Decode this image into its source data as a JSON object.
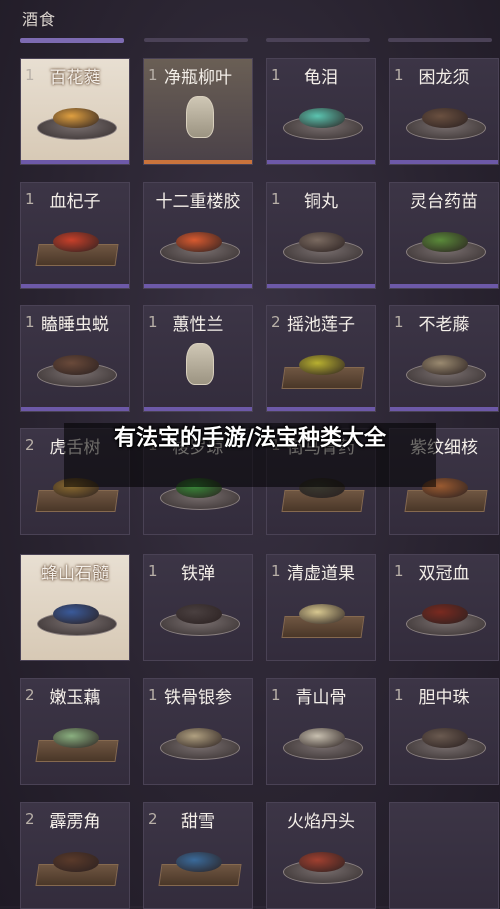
{
  "header": {
    "title": "酒食"
  },
  "overlay": {
    "title": "有法宝的手游/法宝种类大全"
  },
  "items": [
    {
      "count": "1",
      "name": "百花蕤",
      "state": "special",
      "visual": "plate",
      "color": "#e0a040"
    },
    {
      "count": "1",
      "name": "净瓶柳叶",
      "state": "selected",
      "visual": "vase",
      "color": "#b8b090"
    },
    {
      "count": "1",
      "name": "龟泪",
      "state": "normal",
      "visual": "plate",
      "color": "#5bc4b0"
    },
    {
      "count": "1",
      "name": "困龙须",
      "state": "normal",
      "visual": "plate",
      "color": "#6a5040"
    },
    {
      "count": "1",
      "name": "血杞子",
      "state": "normal",
      "visual": "tray",
      "color": "#c8402a"
    },
    {
      "count": "",
      "name": "十二重楼胶",
      "state": "normal",
      "visual": "plate",
      "color": "#d85a30"
    },
    {
      "count": "1",
      "name": "铜丸",
      "state": "normal",
      "visual": "plate",
      "color": "#7a6a60"
    },
    {
      "count": "",
      "name": "灵台药苗",
      "state": "normal",
      "visual": "plate",
      "color": "#5a8a3a"
    },
    {
      "count": "1",
      "name": "瞌睡虫蜕",
      "state": "normal",
      "visual": "plate",
      "color": "#6a4a3a"
    },
    {
      "count": "1",
      "name": "蕙性兰",
      "state": "normal",
      "visual": "vase",
      "color": "#b0a8a0"
    },
    {
      "count": "2",
      "name": "摇池莲子",
      "state": "normal",
      "visual": "tray",
      "color": "#b8b030"
    },
    {
      "count": "1",
      "name": "不老藤",
      "state": "normal",
      "visual": "plate",
      "color": "#9a8a70"
    },
    {
      "count": "2",
      "name": "虎舌树",
      "state": "normal",
      "visual": "tray",
      "color": "#8a6a30"
    },
    {
      "count": "1",
      "name": "梭罗琼",
      "state": "normal",
      "visual": "plate",
      "color": "#3a8a3a"
    },
    {
      "count": "1",
      "name": "街马骨药",
      "state": "normal",
      "visual": "tray",
      "color": "#3a3a30"
    },
    {
      "count": "",
      "name": "紫纹细核",
      "state": "normal",
      "visual": "tray",
      "color": "#9a5a30"
    },
    {
      "count": "",
      "name": "蜂山石髓",
      "state": "special",
      "visual": "plate",
      "color": "#3a5a9a"
    },
    {
      "count": "1",
      "name": "铁弹",
      "state": "normal",
      "visual": "plate",
      "color": "#4a4040"
    },
    {
      "count": "1",
      "name": "清虚道果",
      "state": "normal",
      "visual": "tray",
      "color": "#d8c890"
    },
    {
      "count": "1",
      "name": "双冠血",
      "state": "normal",
      "visual": "plate",
      "color": "#7a2a20"
    },
    {
      "count": "2",
      "name": "嫩玉藕",
      "state": "normal",
      "visual": "tray",
      "color": "#8ab080"
    },
    {
      "count": "1",
      "name": "铁骨银参",
      "state": "normal",
      "visual": "plate",
      "color": "#b0a080"
    },
    {
      "count": "1",
      "name": "青山骨",
      "state": "normal",
      "visual": "plate",
      "color": "#c8c0b0"
    },
    {
      "count": "1",
      "name": "胆中珠",
      "state": "normal",
      "visual": "plate",
      "color": "#6a5a50"
    },
    {
      "count": "2",
      "name": "霹雳角",
      "state": "normal",
      "visual": "tray",
      "color": "#5a3a2a"
    },
    {
      "count": "2",
      "name": "甜雪",
      "state": "normal",
      "visual": "tray",
      "color": "#3a6a9a"
    },
    {
      "count": "",
      "name": "火焰丹头",
      "state": "normal",
      "visual": "plate",
      "color": "#a04030"
    },
    {
      "count": "",
      "name": "",
      "state": "empty",
      "visual": "none",
      "color": "#332c3c"
    }
  ]
}
